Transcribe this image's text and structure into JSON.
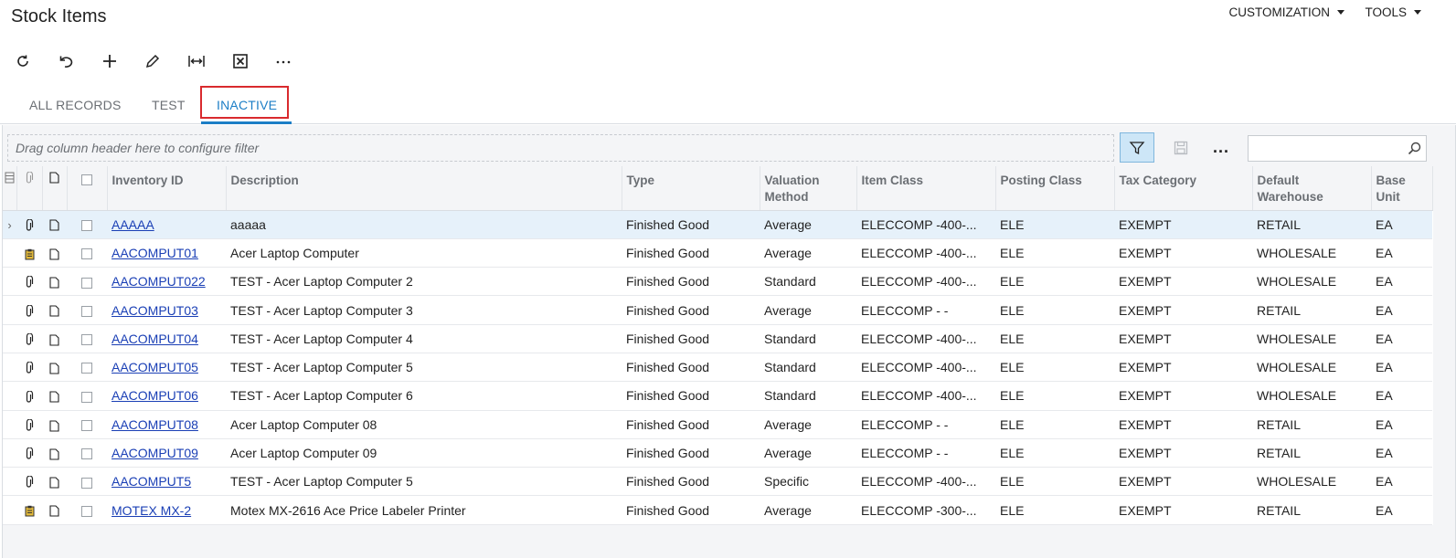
{
  "header": {
    "title": "Stock Items",
    "menus": [
      {
        "label": "CUSTOMIZATION"
      },
      {
        "label": "TOOLS"
      }
    ]
  },
  "toolbar": {
    "buttons": [
      {
        "name": "refresh",
        "icon": "refresh-icon"
      },
      {
        "name": "undo",
        "icon": "undo-icon"
      },
      {
        "name": "add",
        "icon": "plus-icon"
      },
      {
        "name": "edit",
        "icon": "pencil-icon"
      },
      {
        "name": "fit-to-screen",
        "icon": "fit-width-icon"
      },
      {
        "name": "export-excel",
        "icon": "excel-icon"
      },
      {
        "name": "more",
        "icon": "ellipsis-icon"
      }
    ]
  },
  "tabs": [
    {
      "label": "ALL RECORDS",
      "active": false
    },
    {
      "label": "TEST",
      "active": false
    },
    {
      "label": "INACTIVE",
      "active": true
    }
  ],
  "grid": {
    "filter_placeholder": "Drag column header here to configure filter",
    "more_label": "...",
    "search_value": "",
    "columns": [
      "Inventory ID",
      "Description",
      "Type",
      "Valuation Method",
      "Item Class",
      "Posting Class",
      "Tax Category",
      "Default Warehouse",
      "Base Unit"
    ],
    "rows": [
      {
        "attach": "paperclip",
        "id": "AAAAA",
        "description": "aaaaa",
        "type": "Finished Good",
        "valuation": "Average",
        "item_class": "ELECCOMP -400-...",
        "posting": "ELE",
        "tax": "EXEMPT",
        "warehouse": "RETAIL",
        "unit": "EA",
        "selected": true
      },
      {
        "attach": "clipboard",
        "id": "AACOMPUT01",
        "description": "Acer Laptop Computer",
        "type": "Finished Good",
        "valuation": "Average",
        "item_class": "ELECCOMP -400-...",
        "posting": "ELE",
        "tax": "EXEMPT",
        "warehouse": "WHOLESALE",
        "unit": "EA"
      },
      {
        "attach": "paperclip",
        "id": "AACOMPUT022",
        "description": "TEST - Acer Laptop Computer 2",
        "type": "Finished Good",
        "valuation": "Standard",
        "item_class": "ELECCOMP -400-...",
        "posting": "ELE",
        "tax": "EXEMPT",
        "warehouse": "WHOLESALE",
        "unit": "EA"
      },
      {
        "attach": "paperclip",
        "id": "AACOMPUT03",
        "description": "TEST - Acer Laptop Computer 3",
        "type": "Finished Good",
        "valuation": "Average",
        "item_class": "ELECCOMP - -",
        "posting": "ELE",
        "tax": "EXEMPT",
        "warehouse": "RETAIL",
        "unit": "EA"
      },
      {
        "attach": "paperclip",
        "id": "AACOMPUT04",
        "description": "TEST - Acer Laptop Computer 4",
        "type": "Finished Good",
        "valuation": "Standard",
        "item_class": "ELECCOMP -400-...",
        "posting": "ELE",
        "tax": "EXEMPT",
        "warehouse": "WHOLESALE",
        "unit": "EA"
      },
      {
        "attach": "paperclip",
        "id": "AACOMPUT05",
        "description": "TEST - Acer Laptop Computer 5",
        "type": "Finished Good",
        "valuation": "Standard",
        "item_class": "ELECCOMP -400-...",
        "posting": "ELE",
        "tax": "EXEMPT",
        "warehouse": "WHOLESALE",
        "unit": "EA"
      },
      {
        "attach": "paperclip",
        "id": "AACOMPUT06",
        "description": "TEST - Acer Laptop Computer 6",
        "type": "Finished Good",
        "valuation": "Standard",
        "item_class": "ELECCOMP -400-...",
        "posting": "ELE",
        "tax": "EXEMPT",
        "warehouse": "WHOLESALE",
        "unit": "EA"
      },
      {
        "attach": "paperclip",
        "id": "AACOMPUT08",
        "description": "Acer Laptop Computer 08",
        "type": "Finished Good",
        "valuation": "Average",
        "item_class": "ELECCOMP - -",
        "posting": "ELE",
        "tax": "EXEMPT",
        "warehouse": "RETAIL",
        "unit": "EA"
      },
      {
        "attach": "paperclip",
        "id": "AACOMPUT09",
        "description": "Acer Laptop Computer 09",
        "type": "Finished Good",
        "valuation": "Average",
        "item_class": "ELECCOMP - -",
        "posting": "ELE",
        "tax": "EXEMPT",
        "warehouse": "RETAIL",
        "unit": "EA"
      },
      {
        "attach": "paperclip",
        "id": "AACOMPUT5",
        "description": "TEST - Acer Laptop Computer 5",
        "type": "Finished Good",
        "valuation": "Specific",
        "item_class": "ELECCOMP -400-...",
        "posting": "ELE",
        "tax": "EXEMPT",
        "warehouse": "WHOLESALE",
        "unit": "EA"
      },
      {
        "attach": "clipboard",
        "id": "MOTEX MX-2",
        "description": "Motex MX-2616 Ace Price Labeler Printer",
        "type": "Finished Good",
        "valuation": "Average",
        "item_class": "ELECCOMP -300-...",
        "posting": "ELE",
        "tax": "EXEMPT",
        "warehouse": "RETAIL",
        "unit": "EA"
      }
    ]
  },
  "colors": {
    "accent": "#1c7ec6",
    "highlight_box": "#d92a2e",
    "link": "#1a3fb5",
    "selected_row": "#e6f1fa"
  }
}
